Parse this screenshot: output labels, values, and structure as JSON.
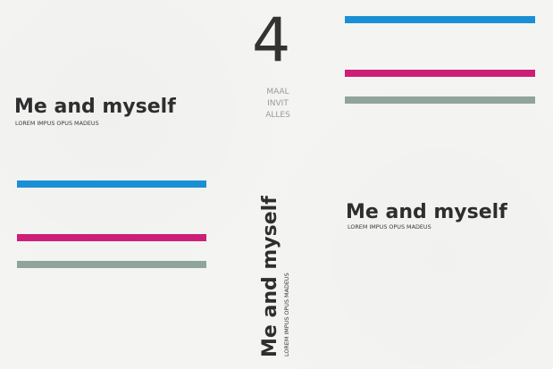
{
  "colors": {
    "blue": "#1b8fd6",
    "magenta": "#cc1f78",
    "gray_green": "#8fa49a"
  },
  "center": {
    "number": "4",
    "words": [
      "MAAL",
      "INVIT",
      "ALLES"
    ]
  },
  "blocks": {
    "left": {
      "title": "Me and myself",
      "subtitle": "LOREM IMPUS OPUS MADEUS"
    },
    "right": {
      "title": "Me and myself",
      "subtitle": "LOREM IMPUS OPUS MADEUS"
    },
    "vertical": {
      "title": "Me and myself",
      "subtitle": "LOREM IMPUS OPUS MADEUS"
    }
  }
}
